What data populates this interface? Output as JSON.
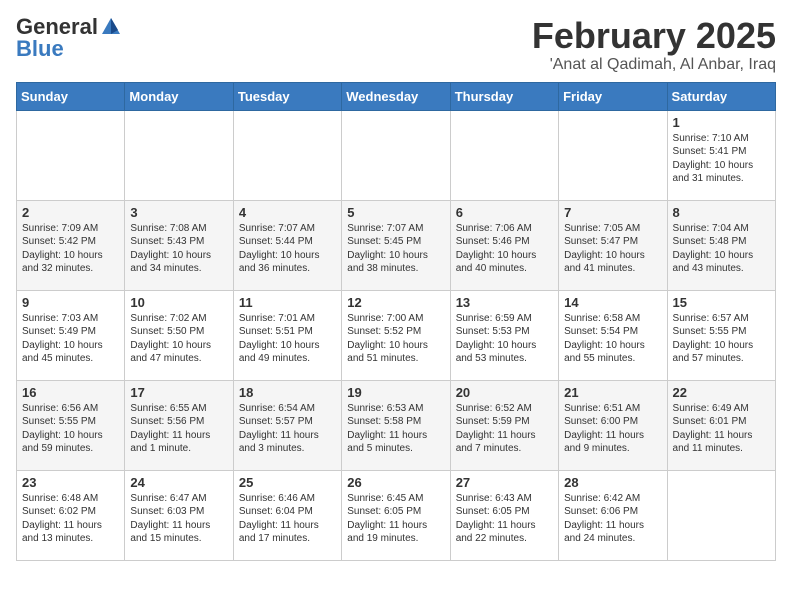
{
  "header": {
    "logo_general": "General",
    "logo_blue": "Blue",
    "month_title": "February 2025",
    "location": "'Anat al Qadimah, Al Anbar, Iraq"
  },
  "weekdays": [
    "Sunday",
    "Monday",
    "Tuesday",
    "Wednesday",
    "Thursday",
    "Friday",
    "Saturday"
  ],
  "weeks": [
    [
      {
        "day": "",
        "info": ""
      },
      {
        "day": "",
        "info": ""
      },
      {
        "day": "",
        "info": ""
      },
      {
        "day": "",
        "info": ""
      },
      {
        "day": "",
        "info": ""
      },
      {
        "day": "",
        "info": ""
      },
      {
        "day": "1",
        "info": "Sunrise: 7:10 AM\nSunset: 5:41 PM\nDaylight: 10 hours\nand 31 minutes."
      }
    ],
    [
      {
        "day": "2",
        "info": "Sunrise: 7:09 AM\nSunset: 5:42 PM\nDaylight: 10 hours\nand 32 minutes."
      },
      {
        "day": "3",
        "info": "Sunrise: 7:08 AM\nSunset: 5:43 PM\nDaylight: 10 hours\nand 34 minutes."
      },
      {
        "day": "4",
        "info": "Sunrise: 7:07 AM\nSunset: 5:44 PM\nDaylight: 10 hours\nand 36 minutes."
      },
      {
        "day": "5",
        "info": "Sunrise: 7:07 AM\nSunset: 5:45 PM\nDaylight: 10 hours\nand 38 minutes."
      },
      {
        "day": "6",
        "info": "Sunrise: 7:06 AM\nSunset: 5:46 PM\nDaylight: 10 hours\nand 40 minutes."
      },
      {
        "day": "7",
        "info": "Sunrise: 7:05 AM\nSunset: 5:47 PM\nDaylight: 10 hours\nand 41 minutes."
      },
      {
        "day": "8",
        "info": "Sunrise: 7:04 AM\nSunset: 5:48 PM\nDaylight: 10 hours\nand 43 minutes."
      }
    ],
    [
      {
        "day": "9",
        "info": "Sunrise: 7:03 AM\nSunset: 5:49 PM\nDaylight: 10 hours\nand 45 minutes."
      },
      {
        "day": "10",
        "info": "Sunrise: 7:02 AM\nSunset: 5:50 PM\nDaylight: 10 hours\nand 47 minutes."
      },
      {
        "day": "11",
        "info": "Sunrise: 7:01 AM\nSunset: 5:51 PM\nDaylight: 10 hours\nand 49 minutes."
      },
      {
        "day": "12",
        "info": "Sunrise: 7:00 AM\nSunset: 5:52 PM\nDaylight: 10 hours\nand 51 minutes."
      },
      {
        "day": "13",
        "info": "Sunrise: 6:59 AM\nSunset: 5:53 PM\nDaylight: 10 hours\nand 53 minutes."
      },
      {
        "day": "14",
        "info": "Sunrise: 6:58 AM\nSunset: 5:54 PM\nDaylight: 10 hours\nand 55 minutes."
      },
      {
        "day": "15",
        "info": "Sunrise: 6:57 AM\nSunset: 5:55 PM\nDaylight: 10 hours\nand 57 minutes."
      }
    ],
    [
      {
        "day": "16",
        "info": "Sunrise: 6:56 AM\nSunset: 5:55 PM\nDaylight: 10 hours\nand 59 minutes."
      },
      {
        "day": "17",
        "info": "Sunrise: 6:55 AM\nSunset: 5:56 PM\nDaylight: 11 hours\nand 1 minute."
      },
      {
        "day": "18",
        "info": "Sunrise: 6:54 AM\nSunset: 5:57 PM\nDaylight: 11 hours\nand 3 minutes."
      },
      {
        "day": "19",
        "info": "Sunrise: 6:53 AM\nSunset: 5:58 PM\nDaylight: 11 hours\nand 5 minutes."
      },
      {
        "day": "20",
        "info": "Sunrise: 6:52 AM\nSunset: 5:59 PM\nDaylight: 11 hours\nand 7 minutes."
      },
      {
        "day": "21",
        "info": "Sunrise: 6:51 AM\nSunset: 6:00 PM\nDaylight: 11 hours\nand 9 minutes."
      },
      {
        "day": "22",
        "info": "Sunrise: 6:49 AM\nSunset: 6:01 PM\nDaylight: 11 hours\nand 11 minutes."
      }
    ],
    [
      {
        "day": "23",
        "info": "Sunrise: 6:48 AM\nSunset: 6:02 PM\nDaylight: 11 hours\nand 13 minutes."
      },
      {
        "day": "24",
        "info": "Sunrise: 6:47 AM\nSunset: 6:03 PM\nDaylight: 11 hours\nand 15 minutes."
      },
      {
        "day": "25",
        "info": "Sunrise: 6:46 AM\nSunset: 6:04 PM\nDaylight: 11 hours\nand 17 minutes."
      },
      {
        "day": "26",
        "info": "Sunrise: 6:45 AM\nSunset: 6:05 PM\nDaylight: 11 hours\nand 19 minutes."
      },
      {
        "day": "27",
        "info": "Sunrise: 6:43 AM\nSunset: 6:05 PM\nDaylight: 11 hours\nand 22 minutes."
      },
      {
        "day": "28",
        "info": "Sunrise: 6:42 AM\nSunset: 6:06 PM\nDaylight: 11 hours\nand 24 minutes."
      },
      {
        "day": "",
        "info": ""
      }
    ]
  ]
}
